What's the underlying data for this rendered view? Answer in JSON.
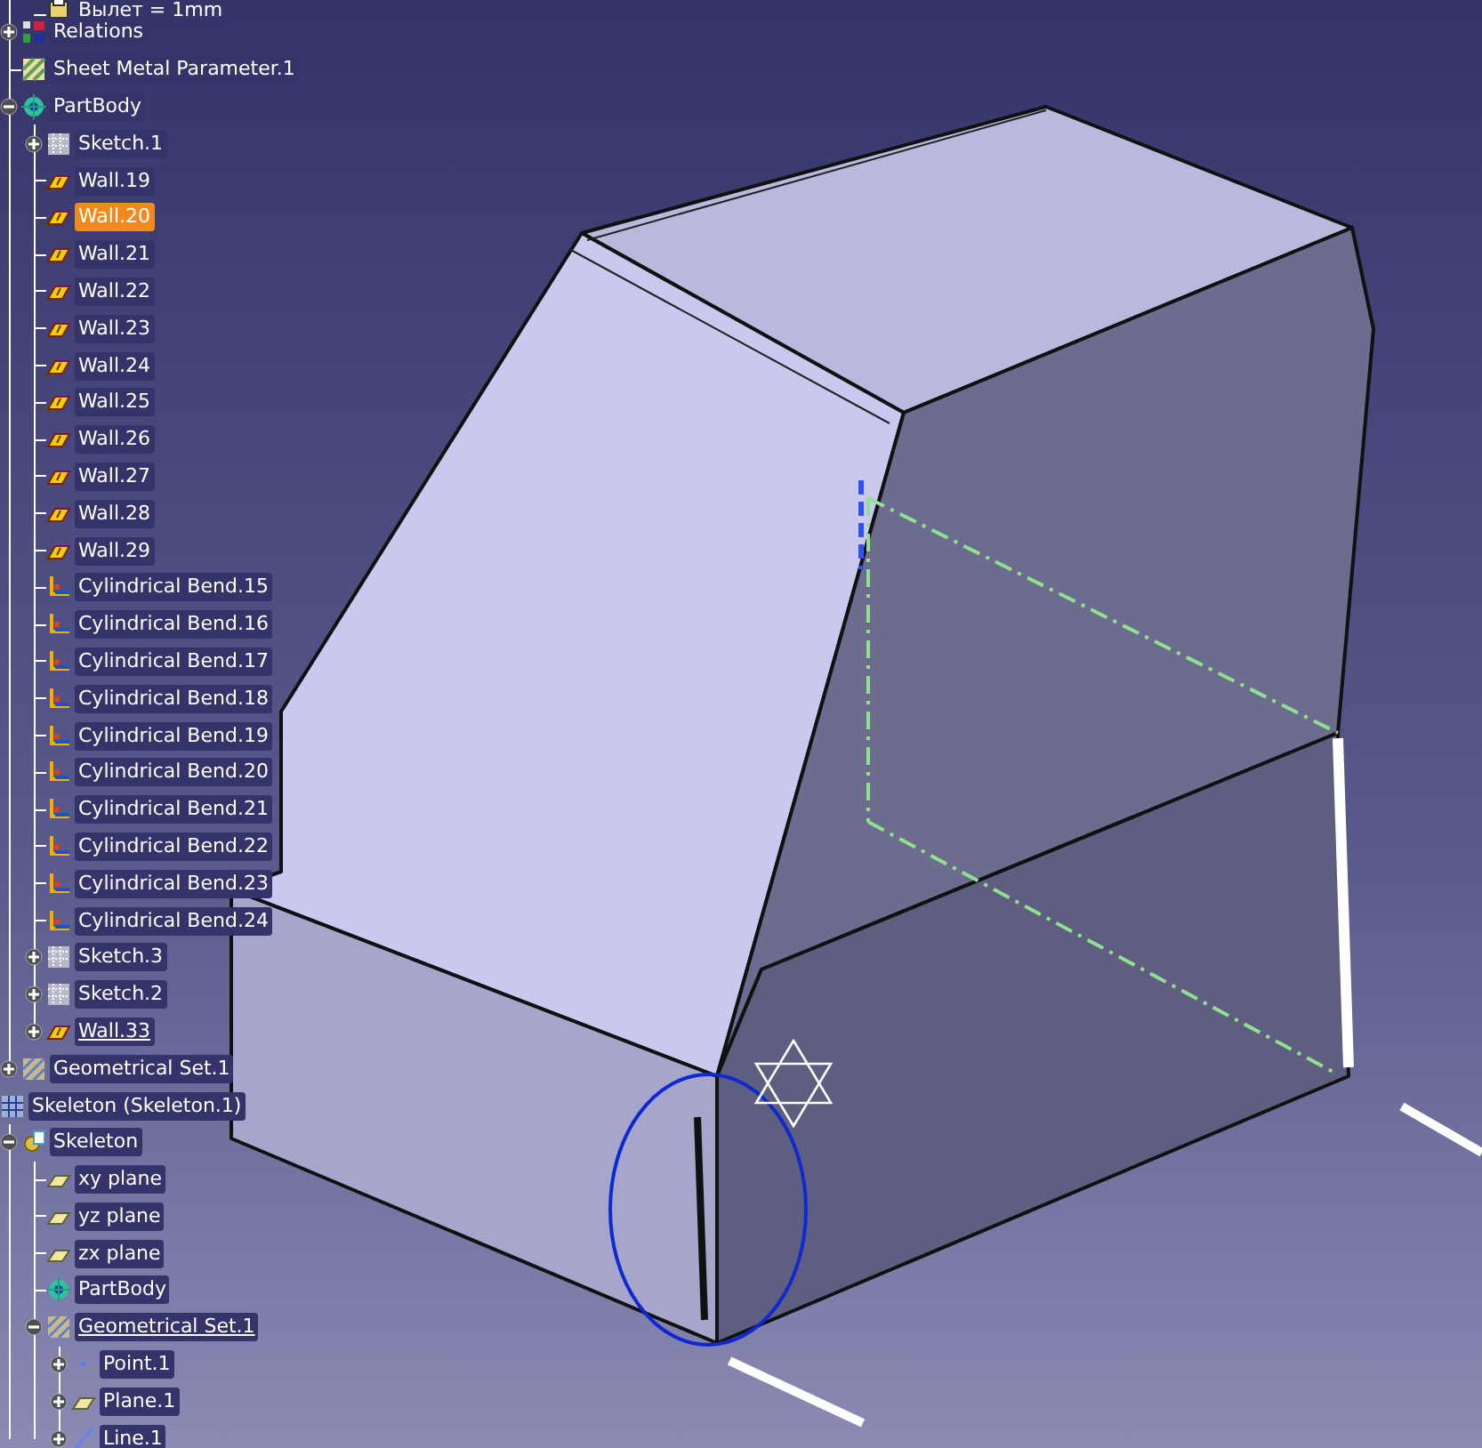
{
  "tree": [
    {
      "children": [
        {
          "children": [
            {
              "label": "Вылет = 1mm",
              "kind": "parameter",
              "selected": false,
              "current": false
            }
          ]
        },
        {
          "label": "Relations",
          "kind": "relations",
          "expanded": false,
          "selected": false,
          "current": false
        },
        {
          "label": "Sheet Metal Parameter.1",
          "kind": "sheetmetal",
          "selected": false,
          "current": false
        },
        {
          "label": "PartBody",
          "kind": "body",
          "expanded": true,
          "selected": false,
          "current": false,
          "children": [
            {
              "label": "Sketch.1",
              "kind": "sketch",
              "expanded": false,
              "selected": false,
              "current": false
            },
            {
              "label": "Wall.19",
              "kind": "wall",
              "selected": false,
              "current": false
            },
            {
              "label": "Wall.20",
              "kind": "wall",
              "selected": true,
              "current": false
            },
            {
              "label": "Wall.21",
              "kind": "wall",
              "selected": false,
              "current": false
            },
            {
              "label": "Wall.22",
              "kind": "wall",
              "selected": false,
              "current": false
            },
            {
              "label": "Wall.23",
              "kind": "wall",
              "selected": false,
              "current": false
            },
            {
              "label": "Wall.24",
              "kind": "wall",
              "selected": false,
              "current": false
            },
            {
              "label": "Wall.25",
              "kind": "wall",
              "selected": false,
              "current": false
            },
            {
              "label": "Wall.26",
              "kind": "wall",
              "selected": false,
              "current": false
            },
            {
              "label": "Wall.27",
              "kind": "wall",
              "selected": false,
              "current": false
            },
            {
              "label": "Wall.28",
              "kind": "wall",
              "selected": false,
              "current": false
            },
            {
              "label": "Wall.29",
              "kind": "wall",
              "selected": false,
              "current": false
            },
            {
              "label": "Cylindrical Bend.15",
              "kind": "bend",
              "selected": false,
              "current": false
            },
            {
              "label": "Cylindrical Bend.16",
              "kind": "bend",
              "selected": false,
              "current": false
            },
            {
              "label": "Cylindrical Bend.17",
              "kind": "bend",
              "selected": false,
              "current": false
            },
            {
              "label": "Cylindrical Bend.18",
              "kind": "bend",
              "selected": false,
              "current": false
            },
            {
              "label": "Cylindrical Bend.19",
              "kind": "bend",
              "selected": false,
              "current": false
            },
            {
              "label": "Cylindrical Bend.20",
              "kind": "bend",
              "selected": false,
              "current": false
            },
            {
              "label": "Cylindrical Bend.21",
              "kind": "bend",
              "selected": false,
              "current": false
            },
            {
              "label": "Cylindrical Bend.22",
              "kind": "bend",
              "selected": false,
              "current": false
            },
            {
              "label": "Cylindrical Bend.23",
              "kind": "bend",
              "selected": false,
              "current": false
            },
            {
              "label": "Cylindrical Bend.24",
              "kind": "bend",
              "selected": false,
              "current": false
            },
            {
              "label": "Sketch.3",
              "kind": "sketch",
              "expanded": false,
              "selected": false,
              "current": false
            },
            {
              "label": "Sketch.2",
              "kind": "sketch",
              "expanded": false,
              "selected": false,
              "current": false
            },
            {
              "label": "Wall.33",
              "kind": "wall",
              "expanded": false,
              "selected": false,
              "current": true
            }
          ]
        },
        {
          "label": "Geometrical Set.1",
          "kind": "geoset",
          "expanded": false,
          "selected": false,
          "current": false
        }
      ]
    },
    {
      "label": "Skeleton (Skeleton.1)",
      "kind": "product",
      "selected": false,
      "current": false,
      "children": [
        {
          "label": "Skeleton",
          "kind": "skeleton",
          "expanded": true,
          "selected": false,
          "current": false,
          "children": [
            {
              "label": "xy plane",
              "kind": "plane",
              "selected": false,
              "current": false
            },
            {
              "label": "yz plane",
              "kind": "plane",
              "selected": false,
              "current": false
            },
            {
              "label": "zx plane",
              "kind": "plane",
              "selected": false,
              "current": false
            },
            {
              "label": "PartBody",
              "kind": "body",
              "selected": false,
              "current": false
            },
            {
              "label": "Geometrical Set.1",
              "kind": "geoset",
              "expanded": true,
              "selected": false,
              "current": true,
              "children": [
                {
                  "label": "Point.1",
                  "kind": "point",
                  "expanded": false,
                  "selected": false,
                  "current": false
                },
                {
                  "label": "Plane.1",
                  "kind": "plane",
                  "expanded": false,
                  "selected": false,
                  "current": false
                },
                {
                  "label": "Line.1",
                  "kind": "line",
                  "expanded": false,
                  "selected": false,
                  "current": false
                }
              ]
            }
          ]
        }
      ]
    }
  ]
}
